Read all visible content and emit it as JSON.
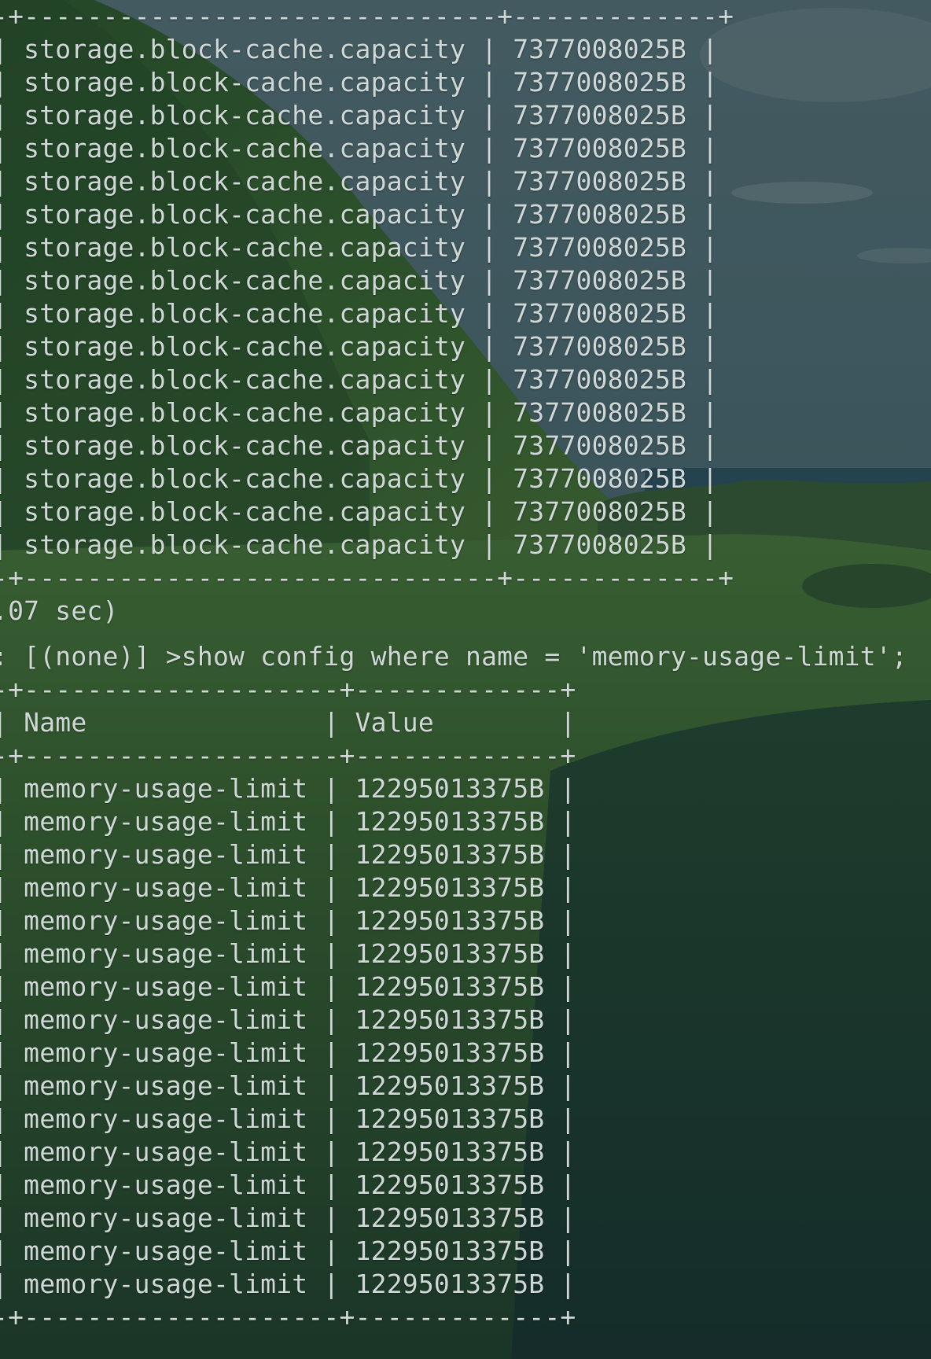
{
  "terminal": {
    "table1": {
      "border": "-+------------------------------+-------------+",
      "rows": [
        {
          "name": "storage.block-cache.capacity",
          "value": "7377008025B"
        },
        {
          "name": "storage.block-cache.capacity",
          "value": "7377008025B"
        },
        {
          "name": "storage.block-cache.capacity",
          "value": "7377008025B"
        },
        {
          "name": "storage.block-cache.capacity",
          "value": "7377008025B"
        },
        {
          "name": "storage.block-cache.capacity",
          "value": "7377008025B"
        },
        {
          "name": "storage.block-cache.capacity",
          "value": "7377008025B"
        },
        {
          "name": "storage.block-cache.capacity",
          "value": "7377008025B"
        },
        {
          "name": "storage.block-cache.capacity",
          "value": "7377008025B"
        },
        {
          "name": "storage.block-cache.capacity",
          "value": "7377008025B"
        },
        {
          "name": "storage.block-cache.capacity",
          "value": "7377008025B"
        },
        {
          "name": "storage.block-cache.capacity",
          "value": "7377008025B"
        },
        {
          "name": "storage.block-cache.capacity",
          "value": "7377008025B"
        },
        {
          "name": "storage.block-cache.capacity",
          "value": "7377008025B"
        },
        {
          "name": "storage.block-cache.capacity",
          "value": "7377008025B"
        },
        {
          "name": "storage.block-cache.capacity",
          "value": "7377008025B"
        },
        {
          "name": "storage.block-cache.capacity",
          "value": "7377008025B"
        }
      ]
    },
    "timing": ".07 sec)",
    "prompt": ": [(none)] >show config where name = 'memory-usage-limit';",
    "table2": {
      "border": "-+--------------------+-------------+",
      "header": {
        "name": "Name",
        "value": "Value"
      },
      "rows": [
        {
          "name": "memory-usage-limit",
          "value": "12295013375B"
        },
        {
          "name": "memory-usage-limit",
          "value": "12295013375B"
        },
        {
          "name": "memory-usage-limit",
          "value": "12295013375B"
        },
        {
          "name": "memory-usage-limit",
          "value": "12295013375B"
        },
        {
          "name": "memory-usage-limit",
          "value": "12295013375B"
        },
        {
          "name": "memory-usage-limit",
          "value": "12295013375B"
        },
        {
          "name": "memory-usage-limit",
          "value": "12295013375B"
        },
        {
          "name": "memory-usage-limit",
          "value": "12295013375B"
        },
        {
          "name": "memory-usage-limit",
          "value": "12295013375B"
        },
        {
          "name": "memory-usage-limit",
          "value": "12295013375B"
        },
        {
          "name": "memory-usage-limit",
          "value": "12295013375B"
        },
        {
          "name": "memory-usage-limit",
          "value": "12295013375B"
        },
        {
          "name": "memory-usage-limit",
          "value": "12295013375B"
        },
        {
          "name": "memory-usage-limit",
          "value": "12295013375B"
        },
        {
          "name": "memory-usage-limit",
          "value": "12295013375B"
        },
        {
          "name": "memory-usage-limit",
          "value": "12295013375B"
        }
      ]
    }
  },
  "colors": {
    "text": "#cfd8d6",
    "overlay": "#14282a"
  }
}
